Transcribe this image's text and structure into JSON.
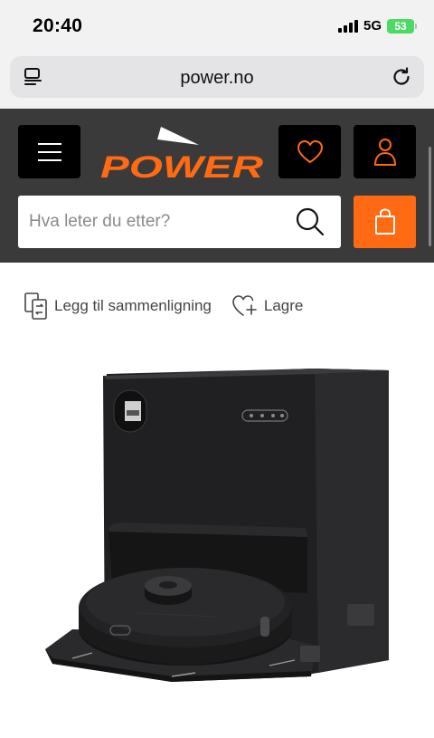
{
  "status_bar": {
    "time": "20:40",
    "network": "5G",
    "battery": "53"
  },
  "browser": {
    "url": "power.no",
    "reader_icon": "reader-mode-icon",
    "reload_icon": "reload-icon"
  },
  "header": {
    "logo_text": "POWER",
    "menu_icon": "hamburger-menu-icon",
    "wishlist_icon": "heart-icon",
    "account_icon": "user-icon",
    "cart_icon": "shopping-bag-icon",
    "search_placeholder": "Hva leter du etter?",
    "search_value": "",
    "colors": {
      "header_bg": "#3a3a3a",
      "accent": "#ff6a12",
      "button_bg": "#000000"
    }
  },
  "actions": {
    "compare_label": "Legg til sammenligning",
    "compare_icon": "compare-icon",
    "save_label": "Lagre",
    "save_icon": "heart-plus-icon"
  },
  "product": {
    "image": "robot-vacuum-with-docking-station"
  }
}
